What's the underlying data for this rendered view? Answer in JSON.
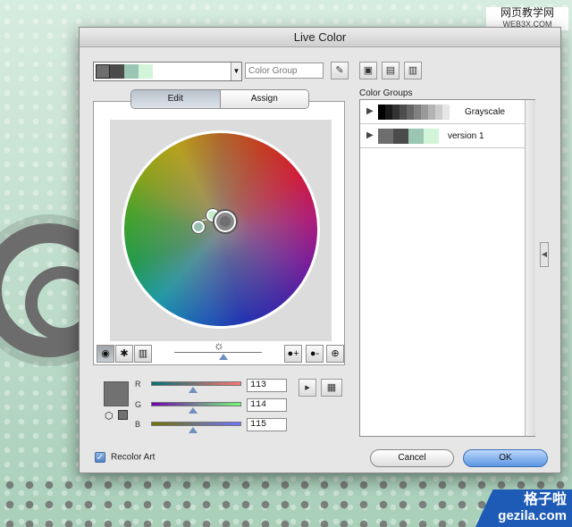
{
  "window": {
    "title": "Live Color"
  },
  "toolbar": {
    "color_group_swatches": [
      "#6e6e6e",
      "#4b4b4b",
      "#9bc6b4",
      "#d2f4d9"
    ],
    "group_name_placeholder": "Color Group",
    "eyedropper_icon": "eyedropper-icon",
    "save_icon": "floppy-icon",
    "new_group_icon": "new-folder-icon",
    "delete_icon": "trash-icon"
  },
  "tabs": {
    "edit": "Edit",
    "assign": "Assign"
  },
  "wheel": {
    "markers": [
      {
        "color": "#c4efcd",
        "role": "color"
      },
      {
        "color": "#96bfae",
        "role": "color"
      },
      {
        "color": "#6f6f6f",
        "role": "base"
      }
    ]
  },
  "wheel_tools": {
    "smooth_wheel_icon": "smooth-wheel-icon",
    "segmented_wheel_icon": "segmented-wheel-icon",
    "bars_icon": "color-bars-icon",
    "brightness_icon": "sun-icon",
    "add_color_icon": "add-color-icon",
    "remove_color_icon": "remove-color-icon",
    "link_icon": "link-icon"
  },
  "current_color": {
    "hex": "#717172",
    "channels": [
      {
        "label": "R",
        "value": "113"
      },
      {
        "label": "G",
        "value": "114"
      },
      {
        "label": "B",
        "value": "115"
      }
    ],
    "slider_fractions": {
      "R": 0.443,
      "G": 0.447,
      "B": 0.451
    }
  },
  "groups": {
    "label": "Color Groups",
    "items": [
      {
        "name": "Grayscale",
        "swatches": [
          "#000000",
          "#1a1a1a",
          "#333333",
          "#4d4d4d",
          "#666666",
          "#808080",
          "#999999",
          "#b3b3b3",
          "#cccccc",
          "#e6e6e6",
          "#ffffff"
        ]
      },
      {
        "name": "version 1",
        "swatches": [
          "#6e6e6e",
          "#4b4b4b",
          "#9bc6b4",
          "#d2f4d9"
        ]
      }
    ]
  },
  "footer": {
    "recolor_label": "Recolor Art",
    "recolor_checked": true,
    "cancel_label": "Cancel",
    "ok_label": "OK"
  },
  "watermarks": {
    "top_line1": "网页教学网",
    "top_line2": "WEB3X.COM",
    "bottom_line1": "格子啦",
    "bottom_line2": "gezila.com"
  }
}
